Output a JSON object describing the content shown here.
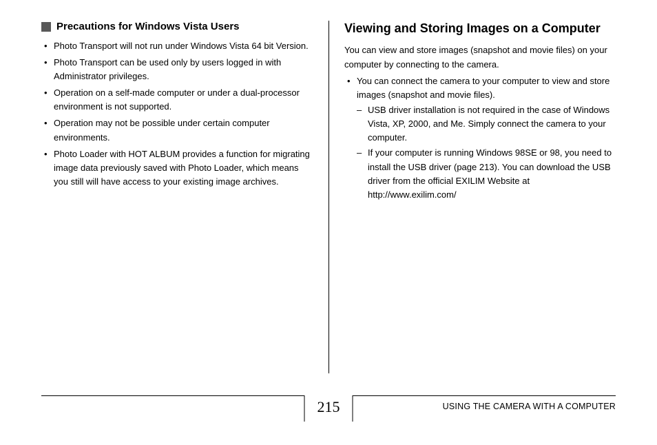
{
  "left": {
    "subheading": "Precautions for Windows Vista Users",
    "bullets": [
      "Photo Transport will not run under Windows Vista 64 bit Version.",
      "Photo Transport can be used only by users logged in with Administrator privileges.",
      "Operation on a self-made computer or under a dual-processor environment is not supported.",
      "Operation may not be possible under certain computer environments.",
      "Photo Loader with HOT ALBUM provides a function for migrating image data previously saved with Photo Loader, which means you still will have access to your existing image archives."
    ]
  },
  "right": {
    "heading": "Viewing and Storing Images on a Computer",
    "intro": "You can view and store images (snapshot and movie files) on your computer by connecting to the camera.",
    "bullet": "You can connect the camera to your computer to view and store images (snapshot and movie files).",
    "dashes": [
      "USB driver installation is not required in the case of Windows Vista, XP, 2000, and Me. Simply connect the camera to your computer.",
      "If your computer is running Windows 98SE or 98, you need to install the USB driver (page 213). You can download the USB driver from the official EXILIM Website at http://www.exilim.com/"
    ]
  },
  "footer": {
    "page_number": "215",
    "section_label": "USING THE CAMERA WITH A COMPUTER"
  }
}
